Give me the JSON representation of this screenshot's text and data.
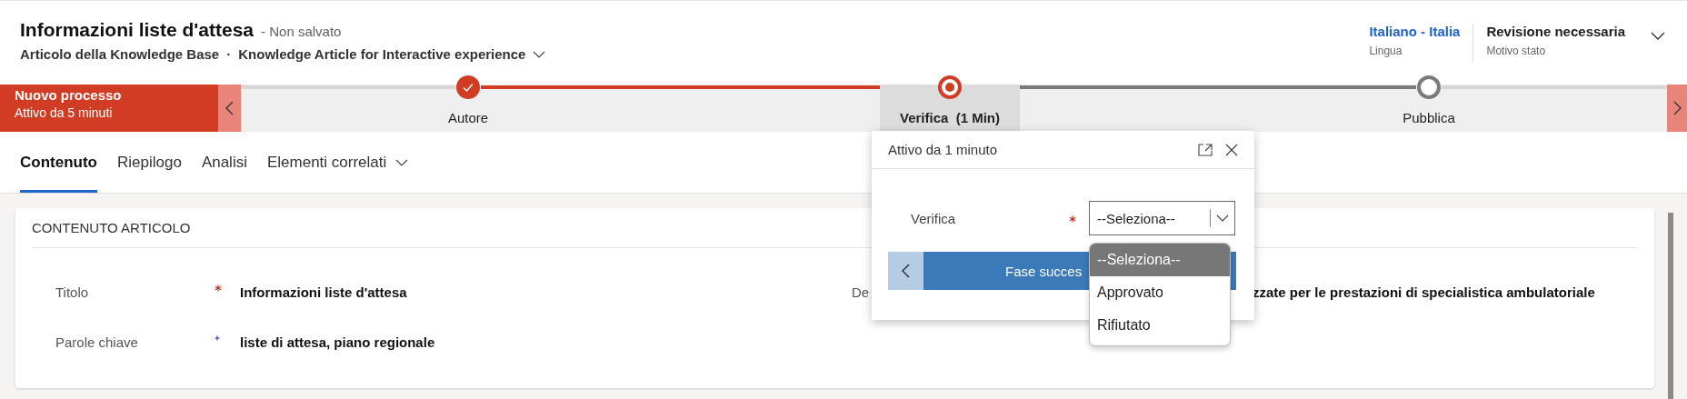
{
  "header": {
    "title": "Informazioni liste d'attesa",
    "save_state": "- Non salvato",
    "entity": "Articolo della Knowledge Base",
    "separator": "·",
    "form": "Knowledge Article for Interactive experience",
    "fields": [
      {
        "value": "Italiano - Italia",
        "label": "Lingua",
        "kind": "link"
      },
      {
        "value": "Revisione necessaria",
        "label": "Motivo stato",
        "kind": "text"
      }
    ]
  },
  "process": {
    "name": "Nuovo processo",
    "duration": "Attivo da 5 minuti",
    "stages": [
      {
        "label": "Autore",
        "kind": "completed",
        "selected": false
      },
      {
        "label": "Verifica  (1 Min)",
        "kind": "active",
        "selected": true
      },
      {
        "label": "Pubblica",
        "kind": "pending",
        "selected": false
      }
    ]
  },
  "tabs": [
    {
      "label": "Contenuto",
      "selected": true,
      "dropdown": false
    },
    {
      "label": "Riepilogo",
      "selected": false,
      "dropdown": false
    },
    {
      "label": "Analisi",
      "selected": false,
      "dropdown": false
    },
    {
      "label": "Elementi correlati",
      "selected": false,
      "dropdown": true
    }
  ],
  "section": {
    "title": "CONTENUTO ARTICOLO",
    "fields": [
      {
        "label": "Titolo",
        "kind": "required",
        "value": "Informazioni liste d'attesa"
      },
      {
        "label": "Parole chiave",
        "kind": "recommended",
        "value": "liste di attesa, piano regionale"
      }
    ],
    "side_field": {
      "label": "De",
      "value": "zzate per le prestazioni di specialistica ambulatoriale"
    }
  },
  "flyout": {
    "title": "Attivo da 1 minuto",
    "field": {
      "label": "Verifica",
      "kind": "required",
      "value": "--Seleziona--"
    },
    "next_button": "Fase succes",
    "options": [
      {
        "label": "--Seleziona--",
        "selected": true
      },
      {
        "label": "Approvato",
        "selected": false
      },
      {
        "label": "Rifiutato",
        "selected": false
      }
    ]
  }
}
